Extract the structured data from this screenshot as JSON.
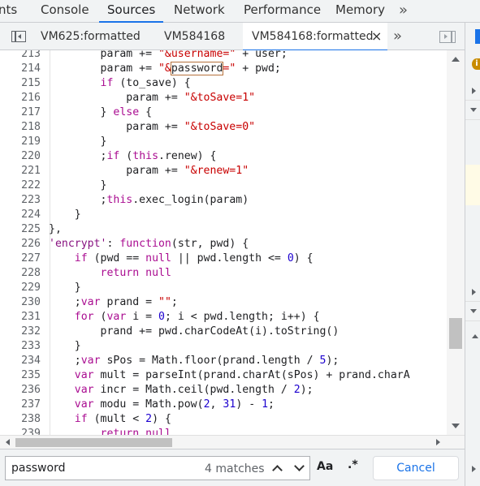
{
  "top_tabs": [
    {
      "label": "nts",
      "active": false
    },
    {
      "label": "Console",
      "active": false
    },
    {
      "label": "Sources",
      "active": true
    },
    {
      "label": "Network",
      "active": false
    },
    {
      "label": "Performance",
      "active": false
    },
    {
      "label": "Memory",
      "active": false
    }
  ],
  "top_more_icon": "chevron-double-right-icon",
  "file_tabs": [
    {
      "label": "VM625:formatted",
      "active": false
    },
    {
      "label": "VM584168",
      "active": false
    },
    {
      "label": "VM584168:formatted",
      "active": true
    }
  ],
  "close_glyph": "×",
  "more_glyph": "»",
  "code": {
    "lines": [
      {
        "n": "213",
        "parts": [
          [
            "",
            "        param += "
          ],
          [
            "str",
            "\"&username=\""
          ],
          [
            "",
            " + user;"
          ]
        ]
      },
      {
        "n": "214",
        "parts": [
          [
            "",
            "        param += "
          ],
          [
            "str",
            "\"&"
          ],
          [
            "match",
            "password"
          ],
          [
            "str",
            "=\""
          ],
          [
            "",
            " + pwd;"
          ]
        ]
      },
      {
        "n": "215",
        "parts": [
          [
            "",
            "        "
          ],
          [
            "kw",
            "if"
          ],
          [
            "",
            " (to_save) {"
          ]
        ]
      },
      {
        "n": "216",
        "parts": [
          [
            "",
            "            param += "
          ],
          [
            "str",
            "\"&toSave=1\""
          ]
        ]
      },
      {
        "n": "217",
        "parts": [
          [
            "",
            "        } "
          ],
          [
            "kw",
            "else"
          ],
          [
            "",
            " {"
          ]
        ]
      },
      {
        "n": "218",
        "parts": [
          [
            "",
            "            param += "
          ],
          [
            "str",
            "\"&toSave=0\""
          ]
        ]
      },
      {
        "n": "219",
        "parts": [
          [
            "",
            "        }"
          ]
        ]
      },
      {
        "n": "220",
        "parts": [
          [
            "",
            "        ;"
          ],
          [
            "kw",
            "if"
          ],
          [
            "",
            " ("
          ],
          [
            "kw",
            "this"
          ],
          [
            "",
            ".renew) {"
          ]
        ]
      },
      {
        "n": "221",
        "parts": [
          [
            "",
            "            param += "
          ],
          [
            "str",
            "\"&renew=1\""
          ]
        ]
      },
      {
        "n": "222",
        "parts": [
          [
            "",
            "        }"
          ]
        ]
      },
      {
        "n": "223",
        "parts": [
          [
            "",
            "        ;"
          ],
          [
            "kw",
            "this"
          ],
          [
            "",
            ".exec_login(param)"
          ]
        ]
      },
      {
        "n": "224",
        "parts": [
          [
            "",
            "    }"
          ]
        ]
      },
      {
        "n": "225",
        "parts": [
          [
            "",
            "},"
          ]
        ]
      },
      {
        "n": "226",
        "parts": [
          [
            "key",
            "'encrypt'"
          ],
          [
            "",
            ": "
          ],
          [
            "kw",
            "function"
          ],
          [
            "",
            "(str, pwd) {"
          ]
        ]
      },
      {
        "n": "227",
        "parts": [
          [
            "",
            "    "
          ],
          [
            "kw",
            "if"
          ],
          [
            "",
            " (pwd == "
          ],
          [
            "kw",
            "null"
          ],
          [
            "",
            " || pwd.length <= "
          ],
          [
            "num",
            "0"
          ],
          [
            "",
            ") {"
          ]
        ]
      },
      {
        "n": "228",
        "parts": [
          [
            "",
            "        "
          ],
          [
            "kw",
            "return"
          ],
          [
            "",
            " "
          ],
          [
            "kw",
            "null"
          ]
        ]
      },
      {
        "n": "229",
        "parts": [
          [
            "",
            "    }"
          ]
        ]
      },
      {
        "n": "230",
        "parts": [
          [
            "",
            "    ;"
          ],
          [
            "kw",
            "var"
          ],
          [
            "",
            " prand = "
          ],
          [
            "str",
            "\"\""
          ],
          [
            "",
            ";"
          ]
        ]
      },
      {
        "n": "231",
        "parts": [
          [
            "",
            "    "
          ],
          [
            "kw",
            "for"
          ],
          [
            "",
            " ("
          ],
          [
            "kw",
            "var"
          ],
          [
            "",
            " i = "
          ],
          [
            "num",
            "0"
          ],
          [
            "",
            "; i < pwd.length; i++) {"
          ]
        ]
      },
      {
        "n": "232",
        "parts": [
          [
            "",
            "        prand += pwd.charCodeAt(i).toString()"
          ]
        ]
      },
      {
        "n": "233",
        "parts": [
          [
            "",
            "    }"
          ]
        ]
      },
      {
        "n": "234",
        "parts": [
          [
            "",
            "    ;"
          ],
          [
            "kw",
            "var"
          ],
          [
            "",
            " sPos = Math.floor(prand.length / "
          ],
          [
            "num",
            "5"
          ],
          [
            "",
            ");"
          ]
        ]
      },
      {
        "n": "235",
        "parts": [
          [
            "",
            "    "
          ],
          [
            "kw",
            "var"
          ],
          [
            "",
            " mult = parseInt(prand.charAt(sPos) + prand.charA"
          ]
        ]
      },
      {
        "n": "236",
        "parts": [
          [
            "",
            "    "
          ],
          [
            "kw",
            "var"
          ],
          [
            "",
            " incr = Math.ceil(pwd.length / "
          ],
          [
            "num",
            "2"
          ],
          [
            "",
            ");"
          ]
        ]
      },
      {
        "n": "237",
        "parts": [
          [
            "",
            "    "
          ],
          [
            "kw",
            "var"
          ],
          [
            "",
            " modu = Math.pow("
          ],
          [
            "num",
            "2"
          ],
          [
            "",
            ", "
          ],
          [
            "num",
            "31"
          ],
          [
            "",
            ") - "
          ],
          [
            "num",
            "1"
          ],
          [
            "",
            ";"
          ]
        ]
      },
      {
        "n": "238",
        "parts": [
          [
            "",
            "    "
          ],
          [
            "kw",
            "if"
          ],
          [
            "",
            " (mult < "
          ],
          [
            "num",
            "2"
          ],
          [
            "",
            ") {"
          ]
        ]
      },
      {
        "n": "239",
        "parts": [
          [
            "",
            "        "
          ],
          [
            "kw",
            "return"
          ],
          [
            "",
            " "
          ],
          [
            "kw",
            "null"
          ]
        ]
      }
    ]
  },
  "search": {
    "value": "password",
    "match_count": "4 matches",
    "case_label": "Aa",
    "regex_label": ".*",
    "cancel_label": "Cancel"
  },
  "right_pane": {
    "info_glyph": "i"
  },
  "colors": {
    "accent": "#1a73e8",
    "keyword": "#aa0d91",
    "string": "#c80000",
    "number": "#1c00cf"
  }
}
